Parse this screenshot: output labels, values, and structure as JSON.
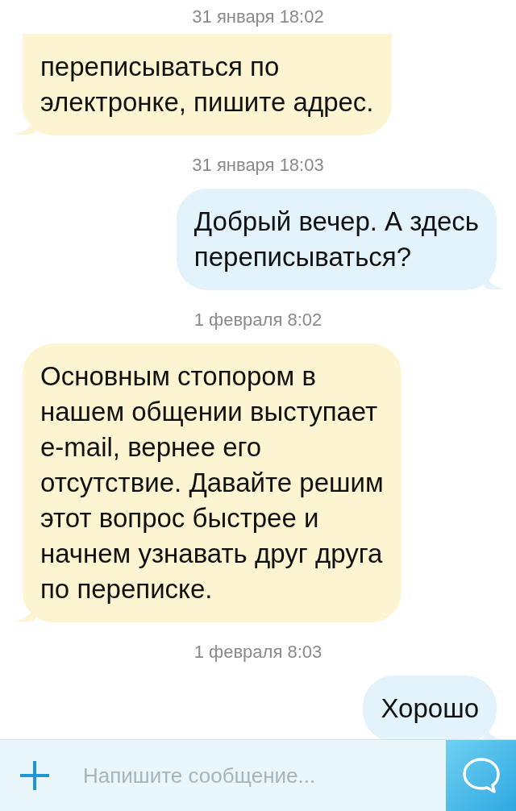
{
  "header_date": "31 января 18:02",
  "messages": [
    {
      "kind": "incoming",
      "text": "переписываться по\nэлектронке, пишите адрес."
    },
    {
      "kind": "date",
      "text": "31 января 18:03"
    },
    {
      "kind": "outgoing",
      "text": "Добрый вечер. А здесь\nпереписываться?"
    },
    {
      "kind": "date",
      "text": "1 февраля 8:02"
    },
    {
      "kind": "incoming",
      "text": "Основным стопором в\nнашем общении выступает\ne-mail, вернее его\nотсутствие. Давайте решим\nэтот вопрос быстрее и\nначнем узнавать друг друга\nпо переписке."
    },
    {
      "kind": "date",
      "text": "1 февраля 8:03"
    },
    {
      "kind": "outgoing",
      "text": "Хорошо"
    }
  ],
  "composer": {
    "placeholder": "Напишите сообщение..."
  }
}
